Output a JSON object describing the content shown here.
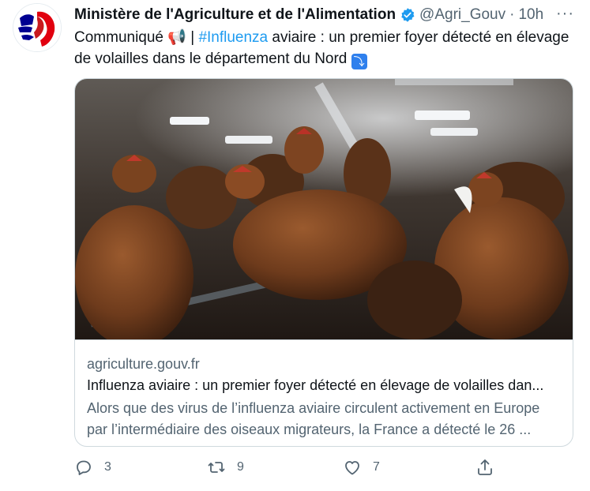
{
  "tweet": {
    "author_name": "Ministère de l'Agriculture et de l'Alimentation",
    "handle": "@Agri_Gouv",
    "separator": "·",
    "time": "10h",
    "more": "···",
    "text_intro": "Communiqué 📢 | ",
    "hashtag": "#Influenza",
    "text_body": " aviaire : un premier foyer détecté en élevage de volailles dans le département du Nord ",
    "emoji_arrow": "⤵"
  },
  "card": {
    "domain": "agriculture.gouv.fr",
    "title": "Influenza aviaire : un premier foyer détecté en élevage de volailles dan...",
    "description": "Alors que des virus de l’influenza aviaire circulent activement en Europe par l’intermédiaire des oiseaux migrateurs, la France a détecté le 26 ..."
  },
  "actions": {
    "reply_count": "3",
    "retweet_count": "9",
    "like_count": "7"
  },
  "colors": {
    "accent": "#1d9bf0",
    "text_secondary": "#536471",
    "border": "#cfd9de"
  }
}
